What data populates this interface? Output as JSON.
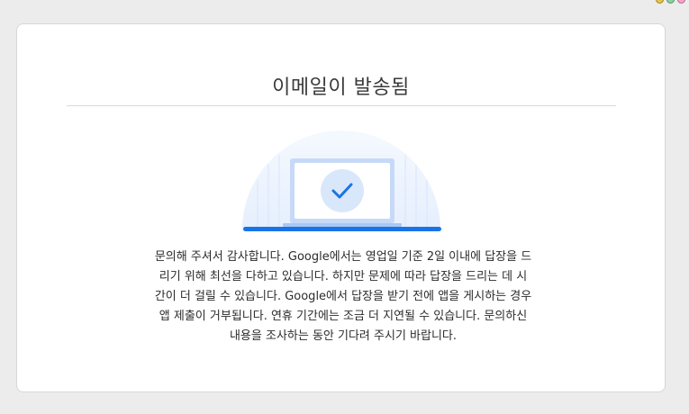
{
  "dialog": {
    "title": "이메일이 발송됨",
    "message_lines": [
      "문의해 주셔서 감사합니다. Google에서는 영업일 기준 2일 이내에 답장을 드",
      "리기 위해 최선을 다하고 있습니다. 하지만 문제에 따라 답장을 드리는 데 시",
      "간이 더 걸릴 수 있습니다. Google에서 답장을 받기 전에 앱을 게시하는 경우",
      "앱 제출이 거부됩니다. 연휴 기간에는 조금 더 지연될 수 있습니다. 문의하신",
      "내용을 조사하는 동안 기다려 주시기 바랍니다."
    ]
  },
  "illustration": {
    "icon": "laptop-checkmark-icon",
    "accent_color": "#1a73e8"
  }
}
